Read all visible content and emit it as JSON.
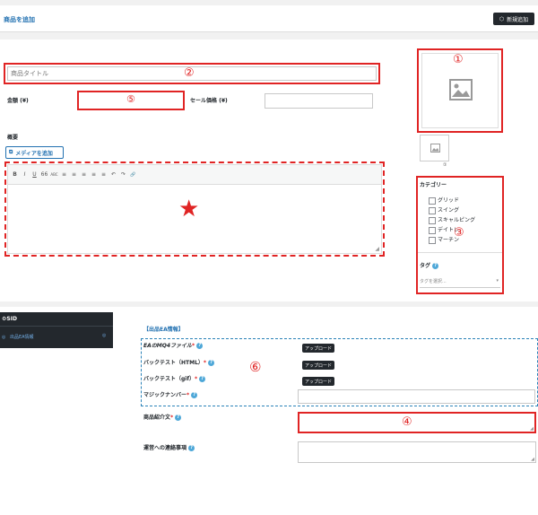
{
  "header": {
    "title": "商品を追加",
    "new_button": "新規追加"
  },
  "editor": {
    "title_placeholder": "商品タイトル",
    "price_label": "金額 (¥)",
    "sale_price_label": "セール価格 (¥)",
    "summary_label": "概要",
    "media_button": "メディアを追加",
    "toolbar": [
      "B",
      "I",
      "U",
      "66",
      "ABC",
      "≡",
      "≡",
      "≡",
      "≡",
      "≡",
      "↶",
      "↷",
      "🔗"
    ]
  },
  "sidebar_box": {
    "category_title": "カテゴリー",
    "categories": [
      "グリッド",
      "スイング",
      "スキャルピング",
      "デイトレ",
      "マーチン"
    ],
    "tag_title": "タグ",
    "tag_placeholder": "タグを選択..."
  },
  "thumb_small_label": "①",
  "bottom": {
    "section_label": "SID",
    "menu_item": "出品EA情報",
    "section_title": "【出品EA情報】",
    "fields": [
      {
        "label": "EAのMQ4ファイル",
        "required": "*",
        "button": "アップロード"
      },
      {
        "label": "バックテスト（HTML）",
        "required": "*",
        "button": "アップロード"
      },
      {
        "label": "バックテスト（gif）",
        "required": "*",
        "button": "アップロード"
      },
      {
        "label": "マジックナンバー",
        "required": "*"
      }
    ],
    "intro_label": "商品紹介文",
    "intro_required": "*",
    "contact_label": "運営への連絡事項"
  },
  "annotations": {
    "n1": "①",
    "n2": "②",
    "n3": "③",
    "n4": "④",
    "n5": "⑤",
    "n6": "⑥",
    "star": "★"
  },
  "colors": {
    "accent": "#2271b1",
    "annotation": "#e02424",
    "annotation_blue": "#2a82b8",
    "admin_bar": "#23282d"
  }
}
